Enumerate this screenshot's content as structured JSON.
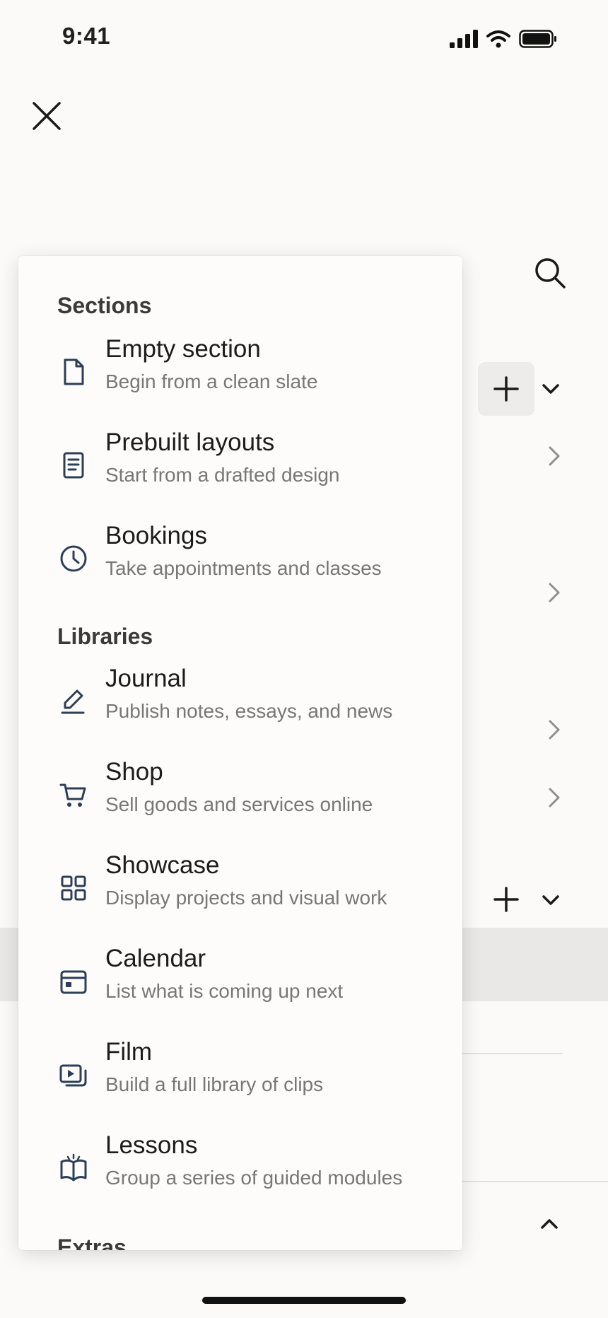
{
  "status_bar": {
    "time": "9:41"
  },
  "sections_heading": "Sections",
  "sections": [
    {
      "title": "Empty section",
      "subtitle": "Begin from a clean slate",
      "icon": "document-icon"
    },
    {
      "title": "Prebuilt layouts",
      "subtitle": "Start from a drafted design",
      "icon": "layout-icon"
    },
    {
      "title": "Bookings",
      "subtitle": "Take appointments and classes",
      "icon": "clock-icon"
    }
  ],
  "libraries_heading": "Libraries",
  "libraries": [
    {
      "title": "Journal",
      "subtitle": "Publish notes, essays, and news",
      "icon": "pencil-icon"
    },
    {
      "title": "Shop",
      "subtitle": "Sell goods and services online",
      "icon": "cart-icon"
    },
    {
      "title": "Showcase",
      "subtitle": "Display projects and visual work",
      "icon": "grid-icon"
    },
    {
      "title": "Calendar",
      "subtitle": "List what is coming up next",
      "icon": "calendar-icon"
    },
    {
      "title": "Film",
      "subtitle": "Build a full library of clips",
      "icon": "video-icon"
    },
    {
      "title": "Lessons",
      "subtitle": "Group a series of guided modules",
      "icon": "book-icon"
    }
  ],
  "extras_heading": "Extras",
  "colors": {
    "icon": "#2d3e57",
    "text": "#1c1c1c",
    "subtext": "#777777",
    "background": "#fbfaf8"
  }
}
